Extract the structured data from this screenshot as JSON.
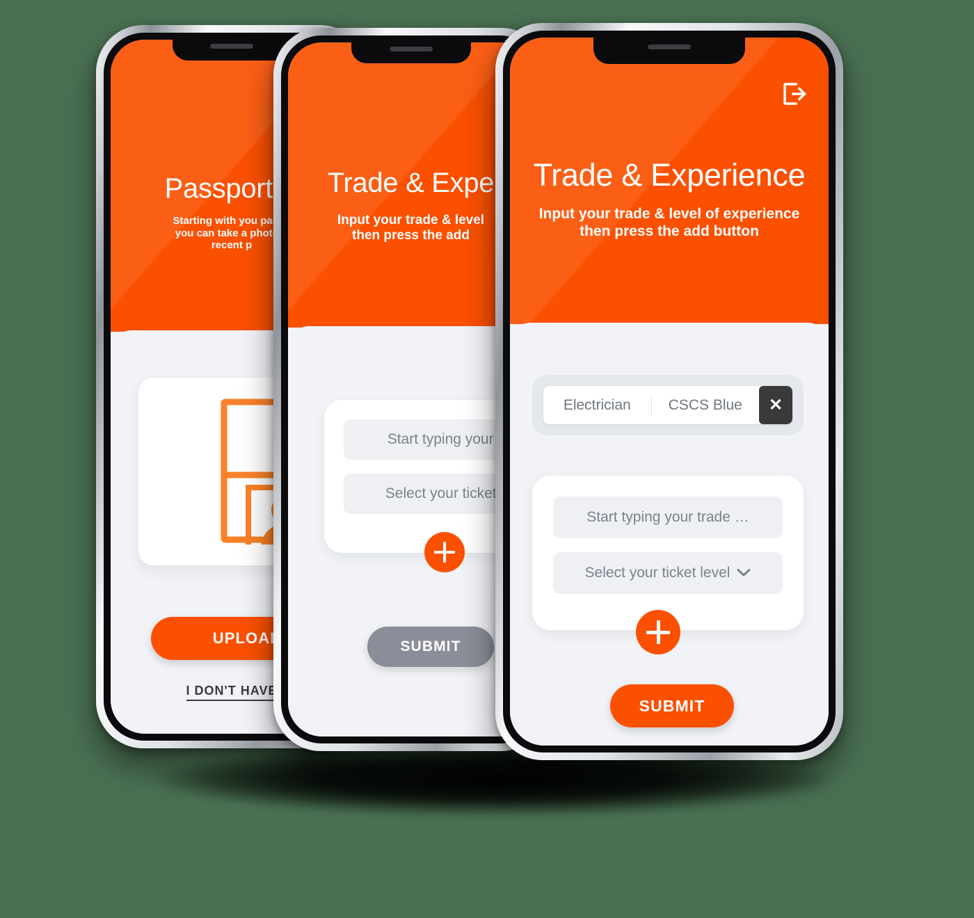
{
  "background_color": "#4a7052",
  "brand": {
    "orange": "#fb5000",
    "orange_light": "#fb6a21",
    "sheet_bg": "#f1f3f7",
    "dark": "#3a3a3a",
    "disabled_gray": "#8b8d98"
  },
  "phones": [
    {
      "id": "passport-verification",
      "position": "back",
      "header": {
        "title": "Passport V",
        "subtitle_lines": [
          "Starting with you passp",
          "you can take a photo o",
          "recent p"
        ]
      },
      "illustration": "passport-photo-icon",
      "primary_button": "UPLOAD P",
      "secondary_link": "I DON'T HAVE"
    },
    {
      "id": "trade-experience-empty",
      "position": "middle",
      "header": {
        "title": "Trade & Expe",
        "subtitle_lines": [
          "Input your trade & level",
          "then press the add"
        ]
      },
      "fields": {
        "trade_placeholder": "Start typing your t",
        "ticket_placeholder": "Select your ticket l"
      },
      "add_button": "add-icon",
      "submit_label": "SUBMIT",
      "submit_state": "disabled"
    },
    {
      "id": "trade-experience-filled",
      "position": "front",
      "logout_icon": "logout-icon",
      "header": {
        "title": "Trade & Experience",
        "subtitle_lines": [
          "Input your trade & level of experience",
          "then press the add button"
        ]
      },
      "chips": [
        {
          "trade": "Electrician",
          "ticket": "CSCS Blue",
          "remove": "✕"
        }
      ],
      "fields": {
        "trade_placeholder": "Start typing your trade …",
        "ticket_placeholder": "Select your ticket level",
        "ticket_chevron": "chevron-down-icon"
      },
      "add_button": "add-icon",
      "submit_label": "SUBMIT",
      "submit_state": "enabled"
    }
  ]
}
